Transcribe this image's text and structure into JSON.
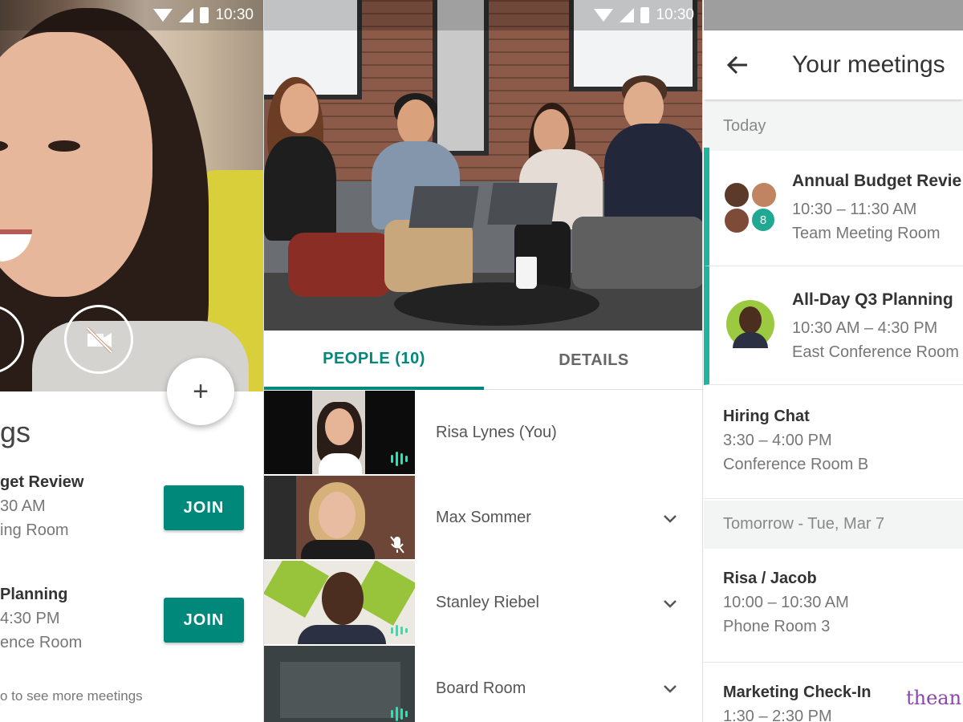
{
  "status_bar": {
    "time": "10:30"
  },
  "left_panel": {
    "heading": "gs",
    "fab_label": "+",
    "meetings": [
      {
        "title": "get Review",
        "time": "30 AM",
        "room": "ing Room",
        "join_label": "JOIN"
      },
      {
        "title": "Planning",
        "time": "4:30 PM",
        "room": "ence Room",
        "join_label": "JOIN"
      }
    ],
    "more_hint": "o to see more meetings"
  },
  "middle_panel": {
    "tabs": [
      {
        "label": "PEOPLE (10)",
        "selected": true
      },
      {
        "label": "DETAILS",
        "selected": false
      }
    ],
    "participants": [
      {
        "name": "Risa Lynes (You)",
        "expandable": false,
        "speaking": true,
        "muted": false
      },
      {
        "name": "Max Sommer",
        "expandable": true,
        "speaking": false,
        "muted": true
      },
      {
        "name": "Stanley Riebel",
        "expandable": true,
        "speaking": true,
        "muted": false
      },
      {
        "name": "Board Room",
        "expandable": true,
        "speaking": true,
        "muted": false
      }
    ]
  },
  "right_panel": {
    "title": "Your meetings",
    "sections": {
      "today": "Today",
      "tomorrow": "Tomorrow - Tue, Mar 7"
    },
    "meetings": [
      {
        "title": "Annual Budget Revie",
        "time": "10:30 – 11:30 AM",
        "room": "Team Meeting Room",
        "extra_count": "8"
      },
      {
        "title": "All-Day Q3 Planning",
        "time": "10:30 AM – 4:30 PM",
        "room": "East Conference Room"
      },
      {
        "title": "Hiring Chat",
        "time": "3:30 – 4:00 PM",
        "room": "Conference Room B"
      },
      {
        "title": "Risa / Jacob",
        "time": "10:00 – 10:30 AM",
        "room": "Phone Room 3"
      },
      {
        "title": "Marketing Check-In",
        "time": "1:30 – 2:30 PM",
        "room": ""
      }
    ]
  },
  "watermark": "thean",
  "colors": {
    "accent": "#00897b",
    "accent_light": "#1fb59e",
    "text_dark": "#333333",
    "text_muted": "#777777"
  }
}
